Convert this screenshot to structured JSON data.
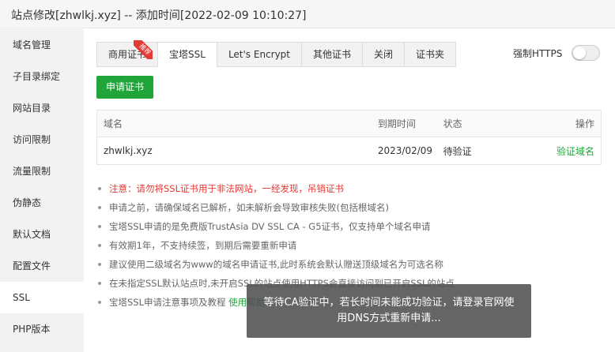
{
  "window": {
    "title": "站点修改[zhwlkj.xyz] -- 添加时间[2022-02-09 10:10:27]"
  },
  "sidebar": {
    "items": [
      {
        "label": "域名管理"
      },
      {
        "label": "子目录绑定"
      },
      {
        "label": "网站目录"
      },
      {
        "label": "访问限制"
      },
      {
        "label": "流量限制"
      },
      {
        "label": "伪静态"
      },
      {
        "label": "默认文档"
      },
      {
        "label": "配置文件"
      },
      {
        "label": "SSL",
        "active": true
      },
      {
        "label": "PHP版本"
      }
    ]
  },
  "tabs": [
    {
      "label": "商用证书",
      "badge": "推荐"
    },
    {
      "label": "宝塔SSL",
      "active": true
    },
    {
      "label": "Let's Encrypt"
    },
    {
      "label": "其他证书"
    },
    {
      "label": "关闭"
    },
    {
      "label": "证书夹"
    }
  ],
  "https_toggle": {
    "label": "强制HTTPS",
    "enabled": false
  },
  "apply_button": {
    "label": "申请证书"
  },
  "table": {
    "headers": [
      "域名",
      "到期时间",
      "状态",
      "操作"
    ],
    "rows": [
      {
        "domain": "zhwlkj.xyz",
        "expiry": "2023/02/09",
        "status": "待验证",
        "action": "验证域名"
      }
    ]
  },
  "notes": [
    {
      "text": "注意：请勿将SSL证书用于非法网站，一经发现，吊销证书",
      "warn": true
    },
    {
      "text": "申请之前，请确保域名已解析，如未解析会导致审核失败(包括根域名)"
    },
    {
      "text": "宝塔SSL申请的是免费版TrustAsia DV SSL CA - G5证书，仅支持单个域名申请"
    },
    {
      "text": "有效期1年，不支持续签，到期后需要重新申请"
    },
    {
      "text": "建议使用二级域名为www的域名申请证书,此时系统会默认赠送顶级域名为可选名称"
    },
    {
      "text": "在未指定SSL默认站点时,未开启SSL的站点使用HTTPS会直接访问到已开启SSL的站点"
    },
    {
      "text": "宝塔SSL申请注意事项及教程",
      "link": "使用帮助"
    }
  ],
  "toast": {
    "message": "等待CA验证中，若长时间未能成功验证，请登录官网使用DNS方式重新申请..."
  },
  "colors": {
    "accent_green": "#20a53a",
    "warn_red": "#e53935",
    "sidebar_bg": "#f2f2f2"
  }
}
